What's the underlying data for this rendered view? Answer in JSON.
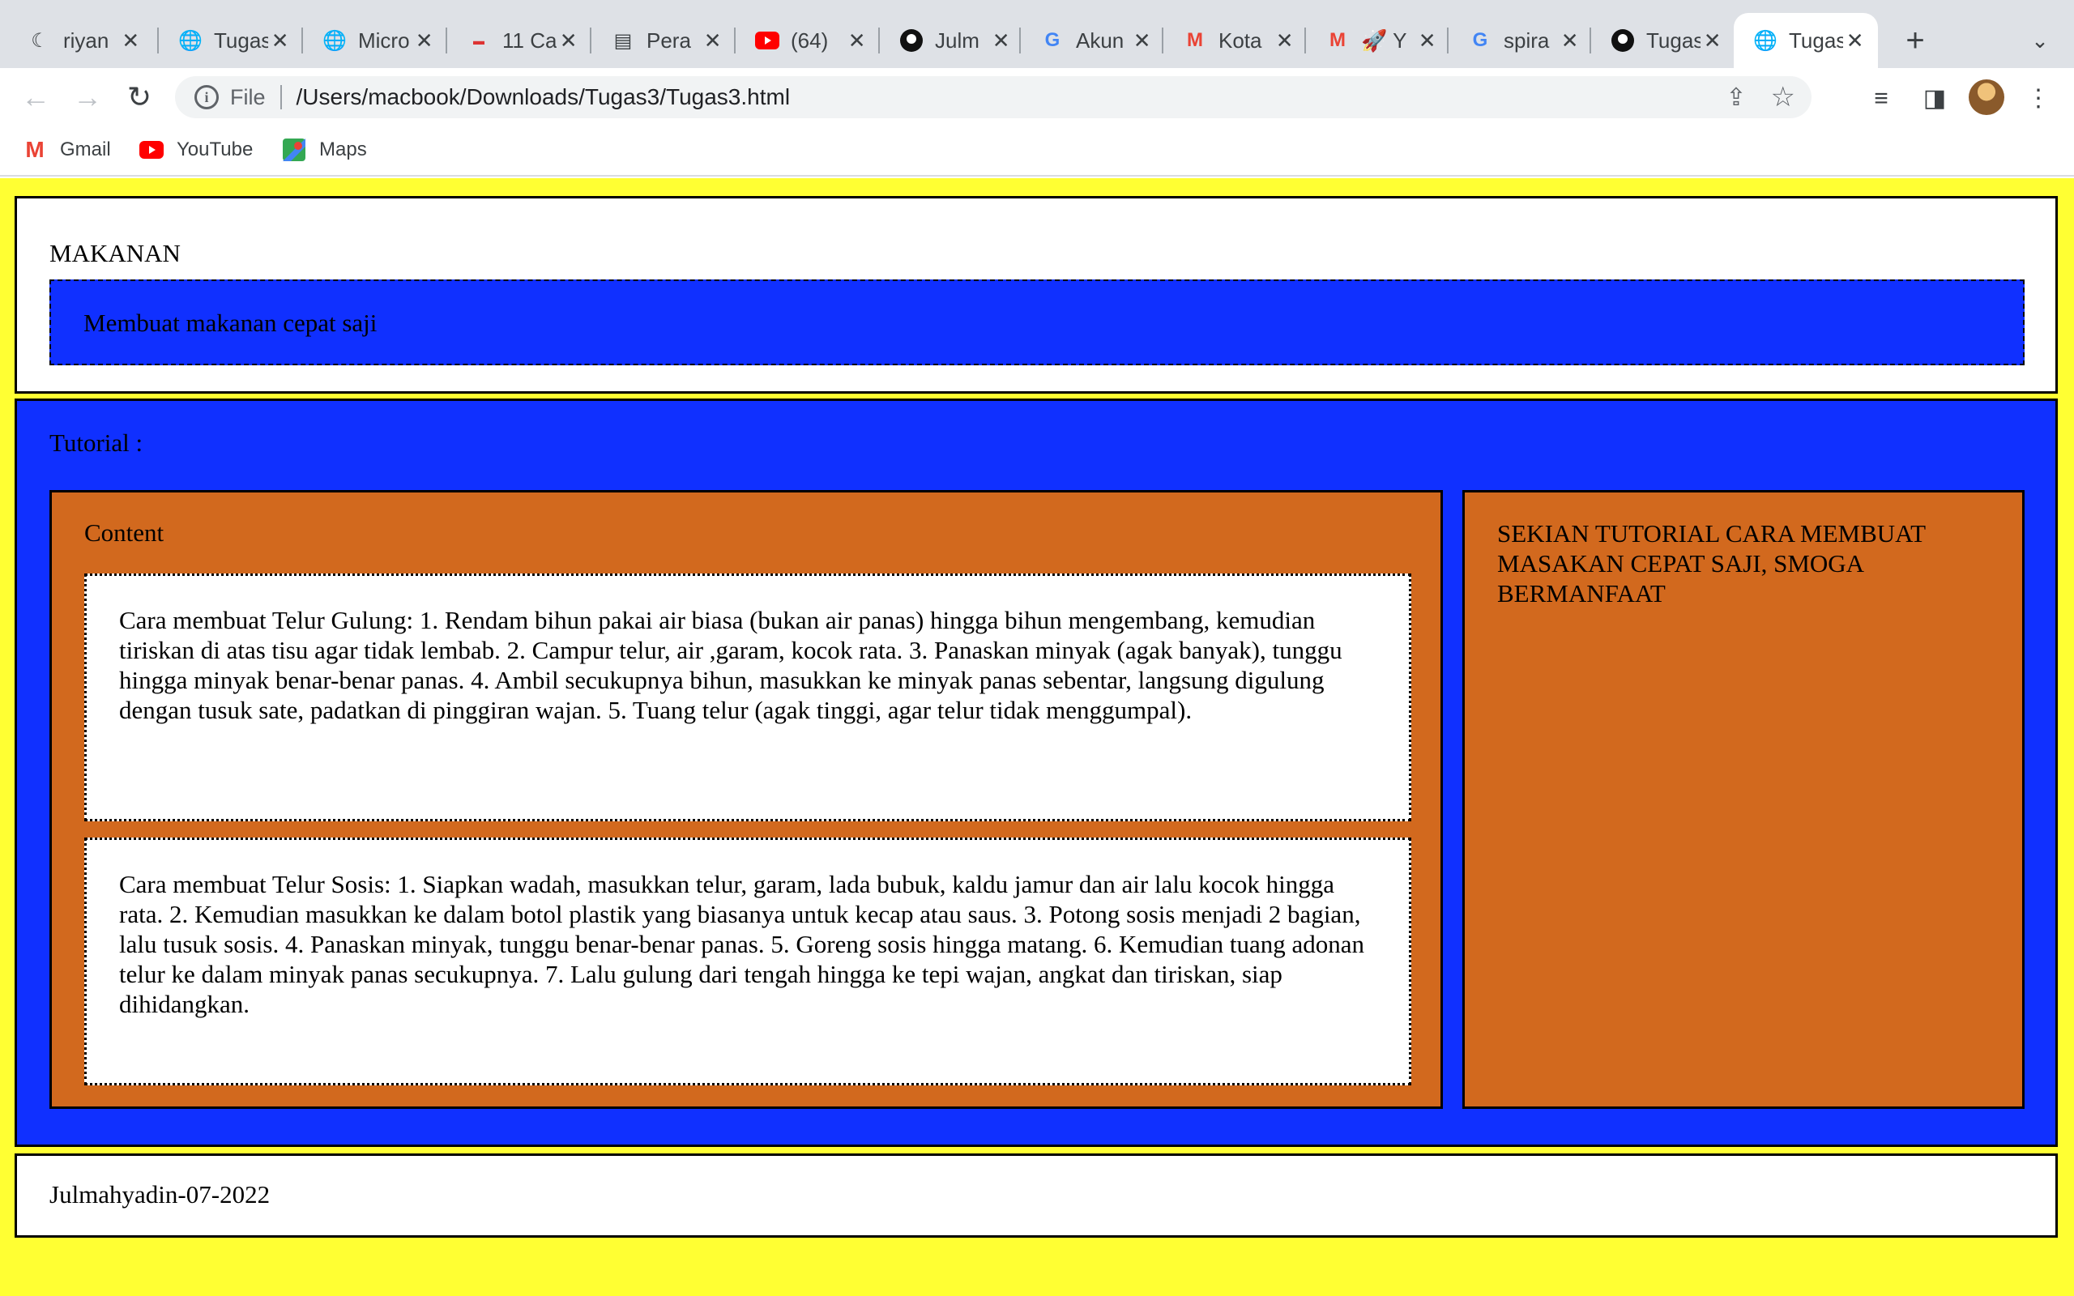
{
  "browser": {
    "tabs": [
      {
        "title": "riyan",
        "icon": "moon-icon"
      },
      {
        "title": "Tugas",
        "icon": "globe-icon"
      },
      {
        "title": "Micro",
        "icon": "globe-icon"
      },
      {
        "title": "11 Ca",
        "icon": "page-icon"
      },
      {
        "title": "Pera",
        "icon": "document-icon"
      },
      {
        "title": "(64)",
        "icon": "youtube-icon"
      },
      {
        "title": "Julm",
        "icon": "github-icon"
      },
      {
        "title": "Akun",
        "icon": "google-icon"
      },
      {
        "title": "Kota",
        "icon": "gmail-icon"
      },
      {
        "title": "🚀 Y",
        "icon": "gmail-icon"
      },
      {
        "title": "spira",
        "icon": "google-icon"
      },
      {
        "title": "Tugas",
        "icon": "github-icon"
      },
      {
        "title": "Tugas",
        "icon": "globe-icon",
        "active": true
      }
    ],
    "address": {
      "scheme_label": "File",
      "url": "/Users/macbook/Downloads/Tugas3/Tugas3.html"
    },
    "bookmarks": [
      {
        "label": "Gmail",
        "icon": "gmail-icon"
      },
      {
        "label": "YouTube",
        "icon": "youtube-icon"
      },
      {
        "label": "Maps",
        "icon": "maps-icon"
      }
    ]
  },
  "page": {
    "header": {
      "title": "MAKANAN",
      "banner": "Membuat makanan cepat saji"
    },
    "main": {
      "title": "Tutorial :",
      "content": {
        "title": "Content",
        "cards": [
          "Cara membuat Telur Gulung: 1. Rendam bihun pakai air biasa (bukan air panas) hingga bihun mengembang, kemudian tiriskan di atas tisu agar tidak lembab. 2. Campur telur, air ,garam, kocok rata. 3. Panaskan minyak (agak banyak), tunggu hingga minyak benar-benar panas. 4. Ambil secukupnya bihun, masukkan ke minyak panas sebentar, langsung digulung dengan tusuk sate, padatkan di pinggiran wajan. 5. Tuang telur (agak tinggi, agar telur tidak menggumpal).",
          "Cara membuat Telur Sosis: 1. Siapkan wadah, masukkan telur, garam, lada bubuk, kaldu jamur dan air lalu kocok hingga rata. 2. Kemudian masukkan ke dalam botol plastik yang biasanya untuk kecap atau saus. 3. Potong sosis menjadi 2 bagian, lalu tusuk sosis. 4. Panaskan minyak, tunggu benar-benar panas. 5. Goreng sosis hingga matang. 6. Kemudian tuang adonan telur ke dalam minyak panas secukupnya. 7. Lalu gulung dari tengah hingga ke tepi wajan, angkat dan tiriskan, siap dihidangkan."
        ]
      },
      "aside": "SEKIAN TUTORIAL CARA MEMBUAT MASAKAN CEPAT SAJI, SMOGA BERMANFAAT"
    },
    "footer": "Julmahyadin-07-2022"
  },
  "colors": {
    "page_background": "#ffff33",
    "blue": "#1030ff",
    "orange": "#d2691e",
    "white": "#ffffff"
  }
}
